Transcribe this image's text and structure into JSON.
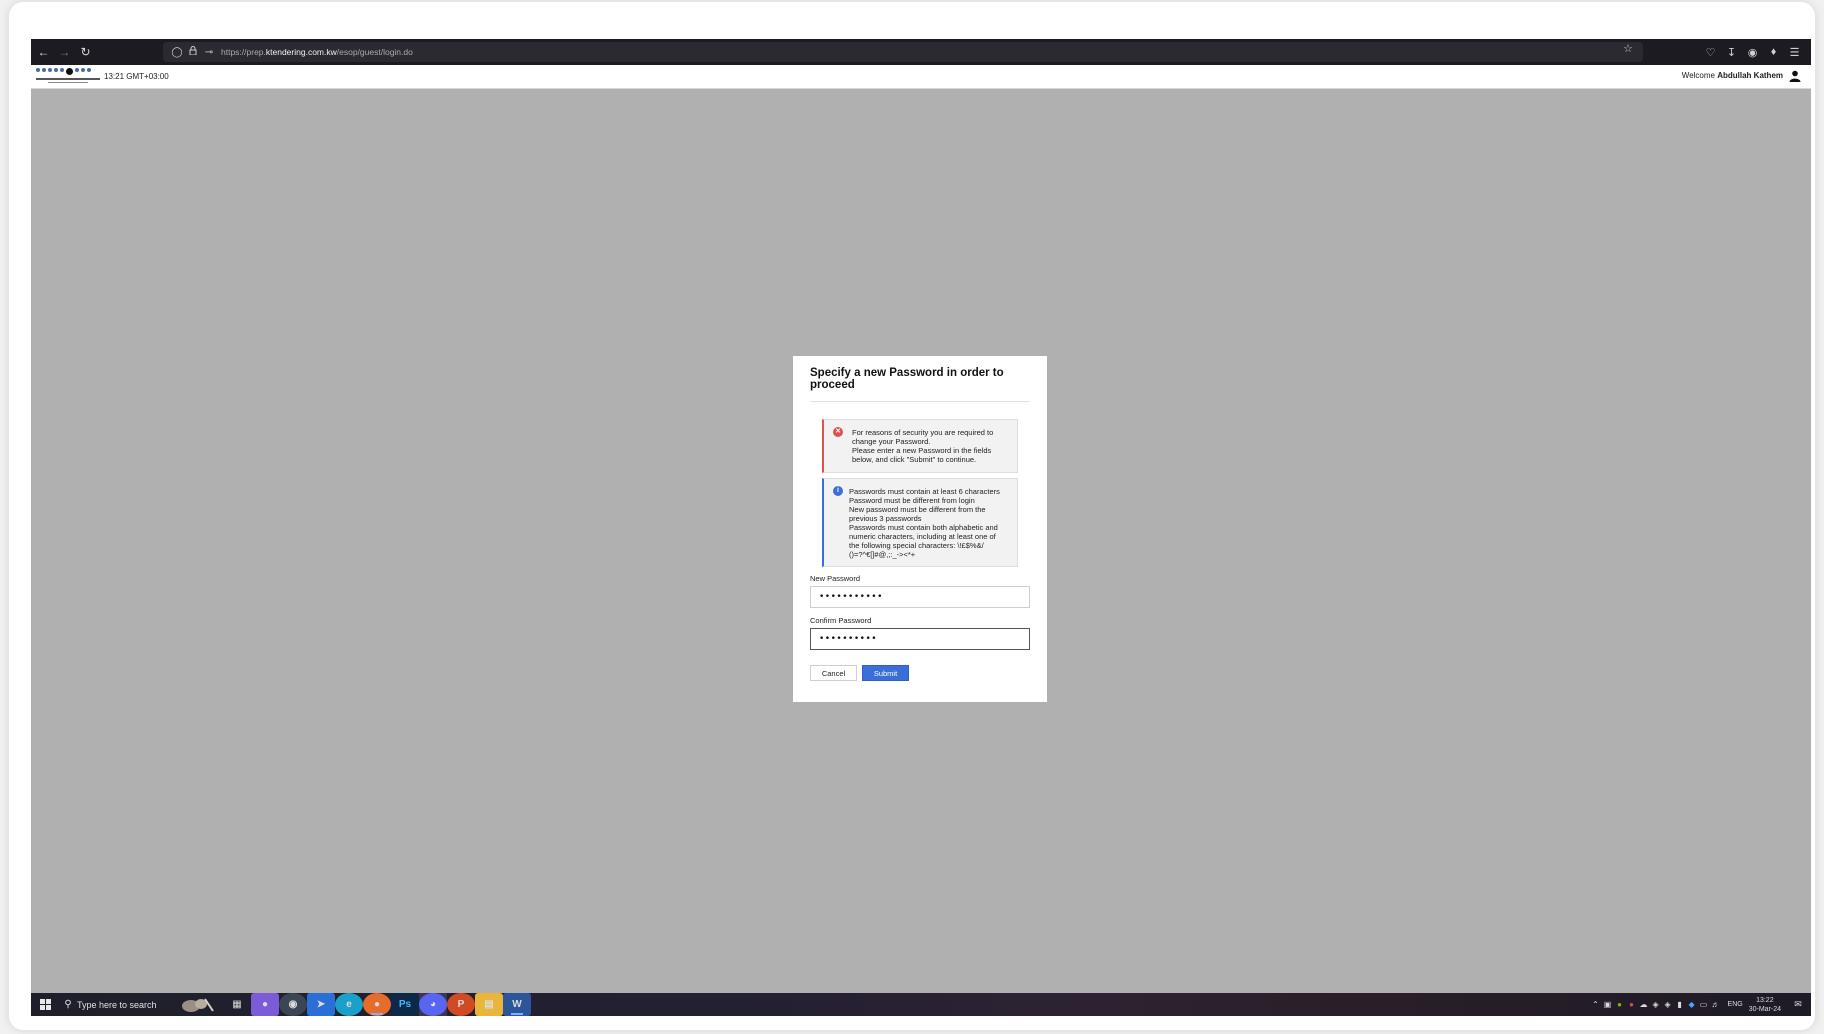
{
  "browser": {
    "url_prefix": "https://prep.",
    "url_domain": "ktendering.com.kw",
    "url_path": "/esop/guest/login.do"
  },
  "header": {
    "clock": "13:21 GMT+03:00",
    "welcome_label": "Welcome",
    "user_name": "Abdullah Kathem"
  },
  "modal": {
    "title": "Specify a new Password in order to proceed",
    "error_lines": [
      "For reasons of security you are required to",
      "change your Password.",
      "Please enter a new Password in the fields",
      "below, and click \"Submit\" to continue."
    ],
    "info_lines": [
      "Passwords must contain at least 6 characters",
      "Password must be different from login",
      "New password must be different from the",
      "previous 3 passwords",
      "Passwords must contain both alphabetic and",
      "numeric characters, including at least one of",
      "the following special characters: \\!£$%&/",
      "()=?^€[]#@,;:_-><*+"
    ],
    "new_password_label": "New Password",
    "new_password_value": "•••••••••••",
    "confirm_password_label": "Confirm Password",
    "confirm_password_value": "••••••••••",
    "cancel_label": "Cancel",
    "submit_label": "Submit"
  },
  "taskbar": {
    "search_placeholder": "Type here to search",
    "language": "ENG",
    "time": "13:22",
    "date": "30-Mar-24",
    "apps": [
      "task-view-icon",
      "gamepad-app-icon",
      "steam-icon",
      "pinned-app-icon",
      "edge-icon",
      "firefox-icon",
      "photoshop-icon",
      "discord-icon",
      "powerpoint-icon",
      "file-explorer-icon",
      "word-icon"
    ]
  },
  "colors": {
    "error_accent": "#d9534f",
    "info_accent": "#3a6fd8",
    "submit_bg": "#3a6fd8",
    "page_bg": "#b0b0b0"
  }
}
